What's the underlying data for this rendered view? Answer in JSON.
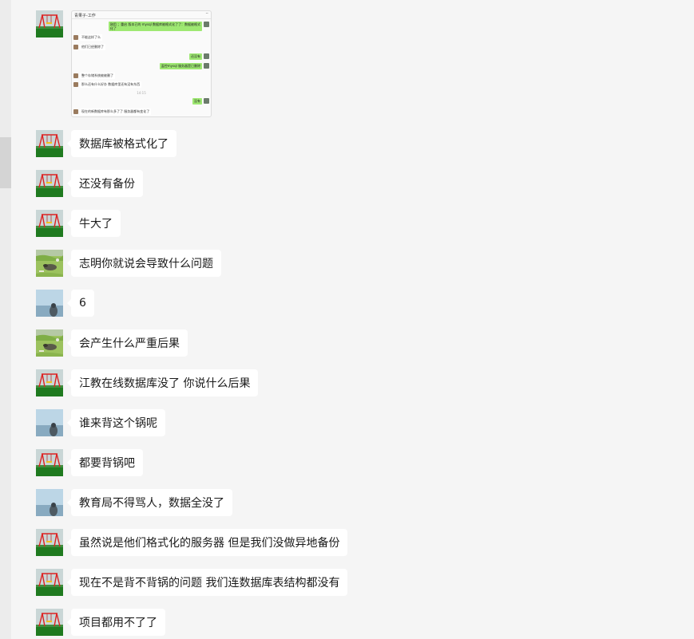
{
  "screenshot_image": {
    "title": "青果子-工作",
    "menu": "···",
    "lines": [
      {
        "side": "right",
        "text": "刚用 ；重启 版本已的 mysql 数据库被格式化了了：数据被格式",
        "text2": "化了"
      },
      {
        "side": "left",
        "text": "不能这样了么"
      },
      {
        "side": "left",
        "text": "他们已经删除了"
      },
      {
        "side": "right",
        "text": "还没有"
      },
      {
        "side": "right",
        "text": "监控mysql 服务器是已删除"
      },
      {
        "side": "left",
        "text": "整个存储系统被被删了"
      },
      {
        "side": "left",
        "text": "那么还有什么好办 数据库里还有没有东西"
      },
      {
        "side": "time",
        "text": "14:15"
      },
      {
        "side": "right",
        "text": "没有"
      },
      {
        "side": "left",
        "text": "现在的新数据库有那么多了了 服务器都有变化了"
      }
    ]
  },
  "messages": [
    {
      "avatar": "swing",
      "text": "数据库被格式化了"
    },
    {
      "avatar": "swing",
      "text": "还没有备份"
    },
    {
      "avatar": "swing",
      "text": "牛大了"
    },
    {
      "avatar": "grass",
      "text": "志明你就说会导致什么问题"
    },
    {
      "avatar": "sea",
      "text": "6"
    },
    {
      "avatar": "grass",
      "text": "会产生什么严重后果"
    },
    {
      "avatar": "swing",
      "text": "江教在线数据库没了 你说什么后果"
    },
    {
      "avatar": "sea",
      "text": "谁来背这个锅呢"
    },
    {
      "avatar": "swing",
      "text": "都要背锅吧"
    },
    {
      "avatar": "sea",
      "text": "教育局不得骂人，数据全没了"
    },
    {
      "avatar": "swing",
      "text": "虽然说是他们格式化的服务器  但是我们没做异地备份"
    },
    {
      "avatar": "swing",
      "text": "现在不是背不背锅的问题  我们连数据库表结构都没有"
    },
    {
      "avatar": "swing",
      "text": "项目都用不了了"
    }
  ]
}
